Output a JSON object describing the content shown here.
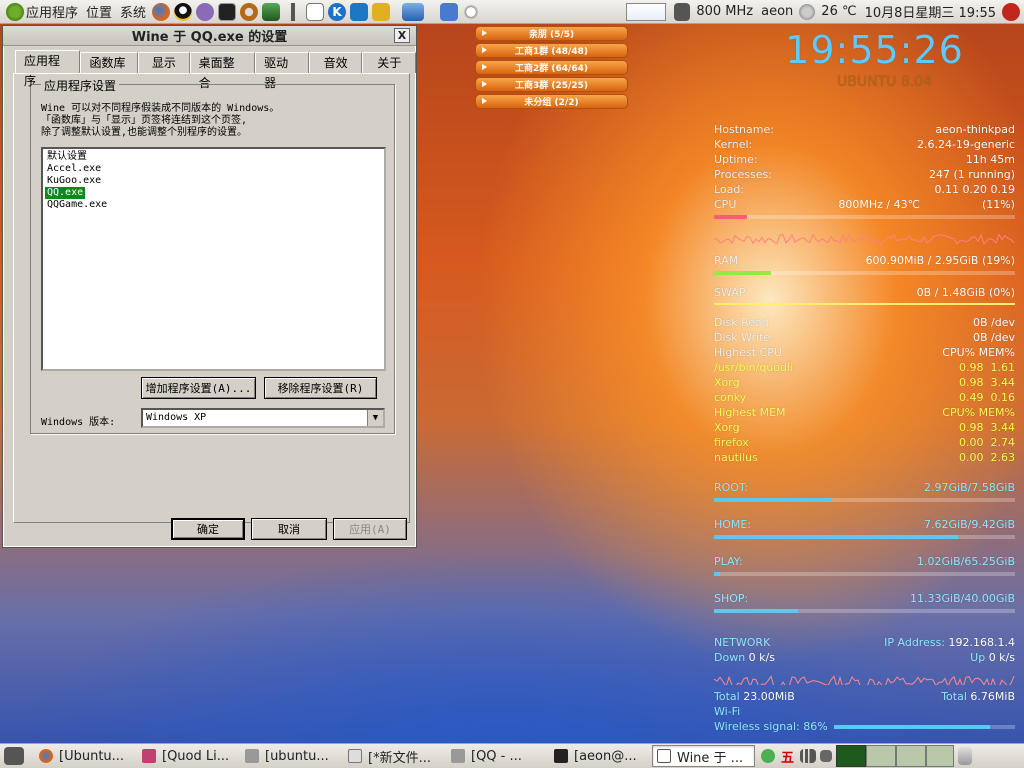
{
  "top_panel": {
    "menus": [
      "应用程序",
      "位置",
      "系统"
    ],
    "cpu_freq": "800 MHz",
    "user": "aeon",
    "weather": "26 ℃",
    "datetime": "10月8日星期三 19:55"
  },
  "wine_window": {
    "title": "Wine 于 QQ.exe 的设置",
    "close": "X",
    "tabs": [
      "应用程序",
      "函数库",
      "显示",
      "桌面整合",
      "驱动器",
      "音效",
      "关于"
    ],
    "group_title": "应用程序设置",
    "description": "Wine 可以对不同程序假装成不同版本的 Windows。\n「函数库」与「显示」页签将连结到这个页签,\n除了调整默认设置,也能调整个别程序的设置。",
    "apps": [
      "默认设置",
      "Accel.exe",
      "KuGoo.exe",
      "QQ.exe",
      "QQGame.exe"
    ],
    "selected_app": "QQ.exe",
    "add_button": "增加程序设置(A)...",
    "remove_button": "移除程序设置(R)",
    "version_label": "Windows 版本:",
    "version_value": "Windows XP",
    "ok_button": "确定",
    "cancel_button": "取消",
    "apply_button": "应用(A)"
  },
  "qq_groups": [
    "亲朋 (5/5)",
    "工商1群 (48/48)",
    "工商2群 (64/64)",
    "工商3群 (25/25)",
    "未分组 (2/2)"
  ],
  "conky": {
    "clock": "19:55:26",
    "distro": "UBUNTU 8.04",
    "hostname_label": "Hostname:",
    "hostname": "aeon-thinkpad",
    "kernel_label": "Kernel:",
    "kernel": "2.6.24-19-generic",
    "uptime_label": "Uptime:",
    "uptime": "11h 45m",
    "processes_label": "Processes:",
    "processes": "247 (1 running)",
    "load_label": "Load:",
    "load": "0.11 0.20 0.19",
    "cpu_label": "CPU",
    "cpu_info": "800MHz / 43℃",
    "cpu_pct": "(11%)",
    "cpu_usage": 0.11,
    "ram_label": "RAM",
    "ram": "600.90MiB / 2.95GiB (19%)",
    "ram_usage": 0.19,
    "swap_label": "SWAP",
    "swap": "0B / 1.48GiB (0%)",
    "swap_usage": 0.0,
    "disk_read_label": "Disk Read",
    "disk_read": "0B /dev",
    "disk_write_label": "Disk Write",
    "disk_write": "0B /dev",
    "top_cpu_header": "Highest CPU",
    "top_cpu_cols": "CPU% MEM%",
    "top_cpu": [
      {
        "name": "/usr/bin/quodli",
        "vals": "0.98  1.61"
      },
      {
        "name": "Xorg",
        "vals": "0.98  3.44"
      },
      {
        "name": "conky",
        "vals": "0.49  0.16"
      }
    ],
    "top_mem_header": "Highest MEM",
    "top_mem_cols": "CPU% MEM%",
    "top_mem": [
      {
        "name": "Xorg",
        "vals": "0.98  3.44"
      },
      {
        "name": "firefox",
        "vals": "0.00  2.74"
      },
      {
        "name": "nautilus",
        "vals": "0.00  2.63"
      }
    ],
    "disks": [
      {
        "label": "ROOT:",
        "value": "2.97GiB/7.58GiB",
        "usage": 0.39
      },
      {
        "label": "HOME:",
        "value": "7.62GiB/9.42GiB",
        "usage": 0.81
      },
      {
        "label": "PLAY:",
        "value": "1.02GiB/65.25GiB",
        "usage": 0.02
      },
      {
        "label": "SHOP:",
        "value": "11.33GiB/40.00GiB",
        "usage": 0.28
      }
    ],
    "network_label": "NETWORK",
    "ip_label": "IP Address:",
    "ip": "192.168.1.4",
    "down_label": "Down",
    "down": "0 k/s",
    "up_label": "Up",
    "up": "0 k/s",
    "total_down_label": "Total",
    "total_down": "23.00MiB",
    "total_up_label": "Total",
    "total_up": "6.76MiB",
    "wifi_label": "Wi-Fi",
    "wireless_label": "Wireless signal:",
    "wireless": "86%",
    "wireless_level": 0.86
  },
  "taskbar": [
    "[Ubuntu...",
    "[Quod Li...",
    "[ubuntu...",
    "[*新文件...",
    "[QQ - ...",
    "[aeon@...",
    "Wine 于 ..."
  ],
  "tray": {
    "ime": "五"
  }
}
